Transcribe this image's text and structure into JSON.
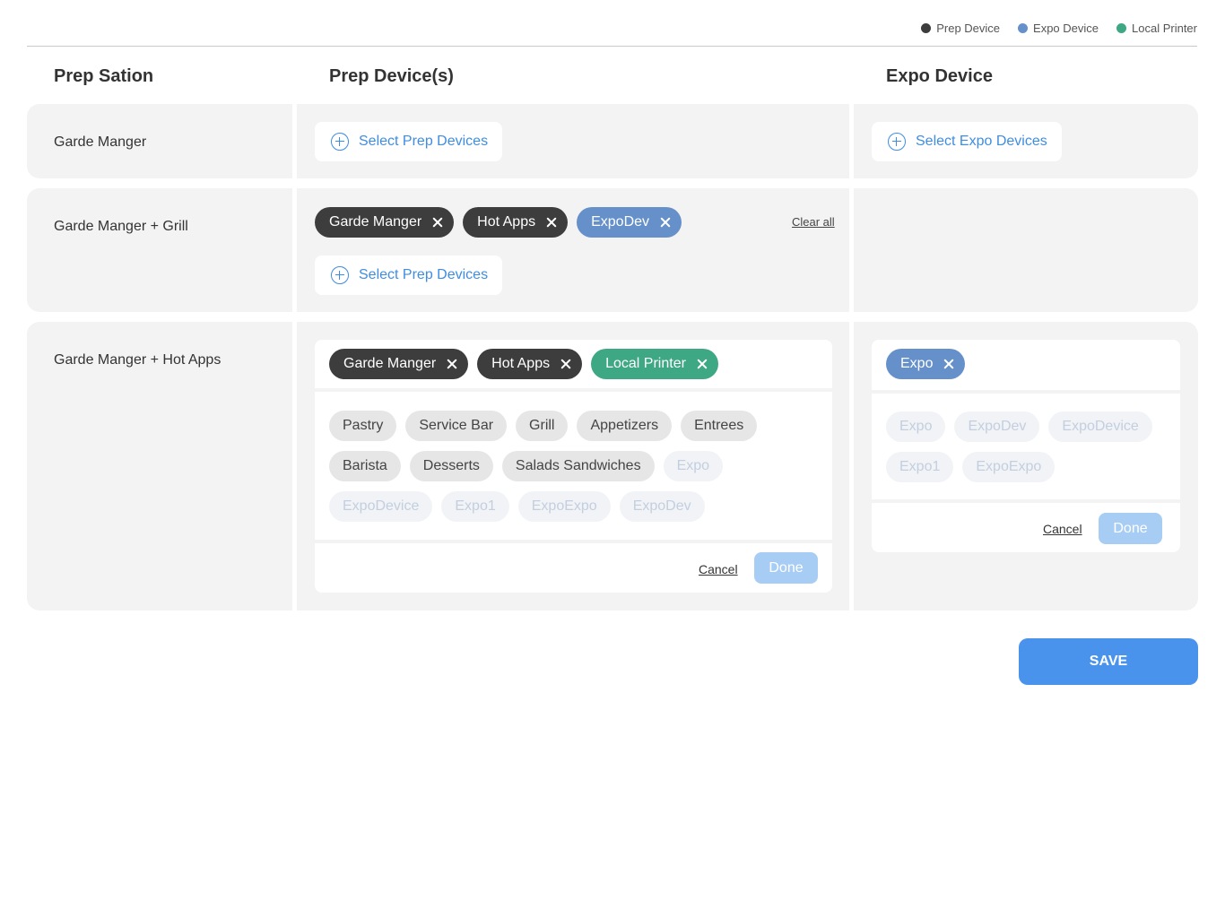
{
  "legend": [
    {
      "label": "Prep Device",
      "color": "#3d3d3d"
    },
    {
      "label": "Expo Device",
      "color": "#6590c9"
    },
    {
      "label": "Local Printer",
      "color": "#3ea784"
    }
  ],
  "headers": {
    "station": "Prep Sation",
    "prep": "Prep Device(s)",
    "expo": "Expo Device"
  },
  "rows": [
    {
      "label": "Garde Manger",
      "prep_button": "Select Prep Devices",
      "expo_button": "Select Expo Devices"
    },
    {
      "label": "Garde Manger + Grill",
      "chips": [
        "Garde Manger",
        "Hot Apps",
        "ExpoDev"
      ],
      "clear_all": "Clear all",
      "prep_button": "Select Prep Devices"
    },
    {
      "label": "Garde Manger + Hot Apps",
      "prep_chips": [
        "Garde Manger",
        "Hot Apps",
        "Local Printer"
      ],
      "prep_options": [
        "Pastry",
        "Service Bar",
        "Grill",
        "Appetizers",
        "Entrees",
        "Barista",
        "Desserts",
        "Salads Sandwiches",
        "Expo",
        "ExpoDevice",
        "Expo1",
        "ExpoExpo",
        "ExpoDev"
      ],
      "expo_chips": [
        "Expo"
      ],
      "expo_options": [
        "Expo",
        "ExpoDev",
        "ExpoDevice",
        "Expo1",
        "ExpoExpo"
      ],
      "cancel": "Cancel",
      "done": "Done"
    }
  ],
  "save": "SAVE"
}
